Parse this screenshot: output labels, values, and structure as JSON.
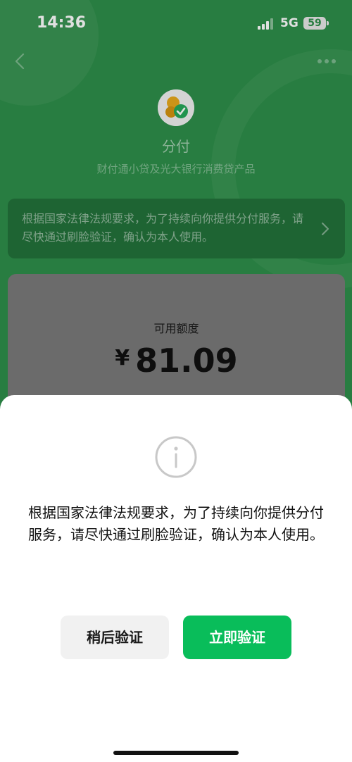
{
  "status_bar": {
    "time": "14:36",
    "network": "5G",
    "battery": "59",
    "icons": [
      "signal-icon",
      "battery-icon"
    ]
  },
  "nav": {
    "icons": [
      "back-chevron-icon",
      "more-icon"
    ]
  },
  "product": {
    "name": "分付",
    "subtitle": "财付通小贷及光大银行消费贷产品",
    "logo_icon": "fenfu-logo-icon"
  },
  "notice": {
    "text": "根据国家法律法规要求，为了持续向你提供分付服务，请尽快通过刷脸验证，确认为本人使用。"
  },
  "credit": {
    "label": "可用额度",
    "currency": "¥",
    "amount": "81.09"
  },
  "dialog": {
    "icon": "info-icon",
    "message": "根据国家法律法规要求，为了持续向你提供分付服务，请尽快通过刷脸验证，确认为本人使用。",
    "later_label": "稍后验证",
    "now_label": "立即验证"
  },
  "colors": {
    "header_green": "#2e8f4a",
    "primary_button": "#09bd5a",
    "secondary_button": "#f1f1f1",
    "sheet_background": "#ffffff"
  }
}
